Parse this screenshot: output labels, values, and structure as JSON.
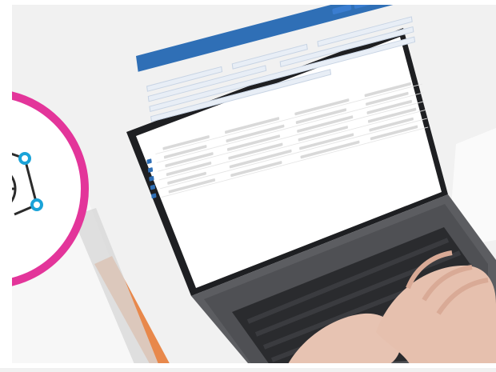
{
  "scene": {
    "description_ui": {
      "top_bar_brand": "",
      "page_title": ""
    }
  },
  "colors": {
    "background": "#f1f1f1",
    "desk": "#e9e9e9",
    "laptop_body": "#5c5d61",
    "laptop_bezel": "#1e1f22",
    "screen_bg": "#ffffff",
    "ui_accent": "#2f6fb6",
    "badge_ring": "#e3359a",
    "badge_fill": "#ffffff",
    "badge_nodes": "#1aa3d8",
    "globe_stroke": "#2b2b2b",
    "notebook": "#f7f7f7",
    "orange_accent": "#e6762e"
  },
  "icons": {
    "badge_icon": "globe-network-icon"
  }
}
